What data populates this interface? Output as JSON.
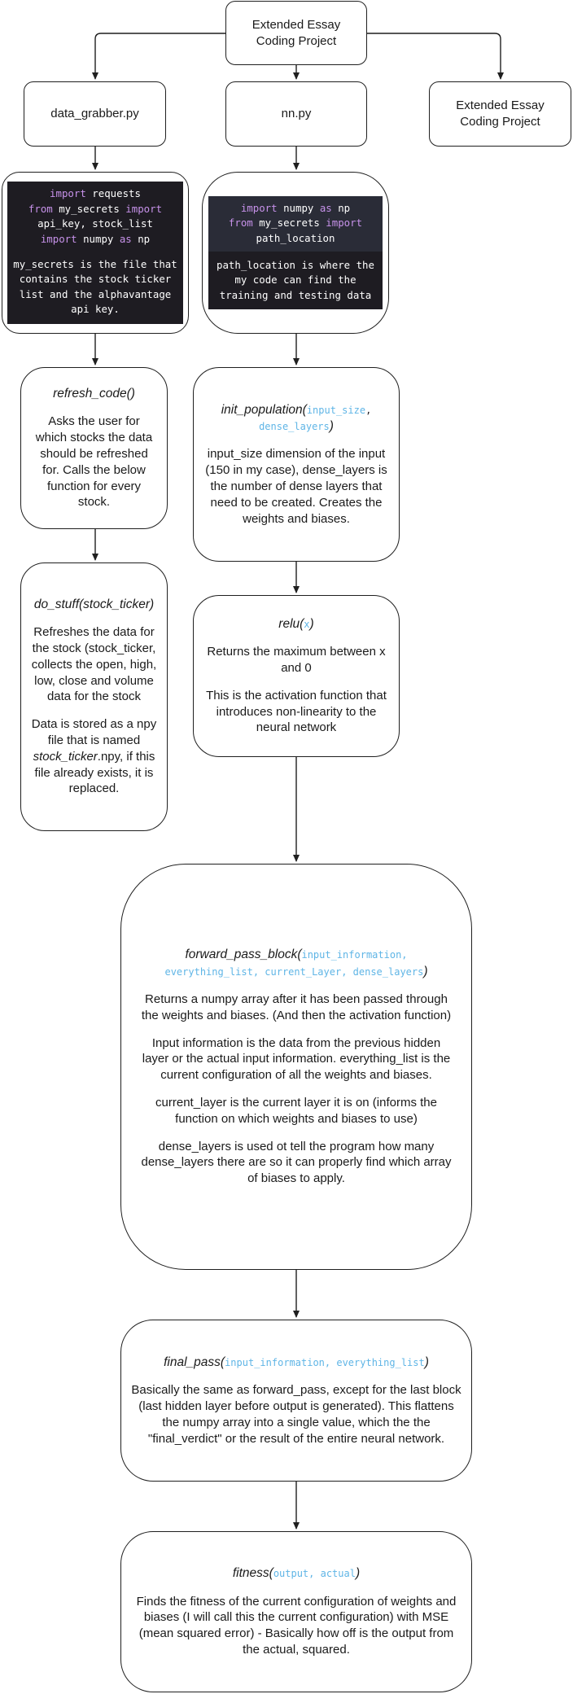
{
  "nodes": {
    "root": {
      "label_line1": "Extended Essay",
      "label_line2": "Coding Project"
    },
    "data_grabber": {
      "label": "data_grabber.py"
    },
    "nn": {
      "label": "nn.py"
    },
    "side": {
      "label_line1": "Extended Essay",
      "label_line2": "Coding Project"
    },
    "data_imports": {
      "line1_kw": "import",
      "line1_rest": " requests",
      "line2_kw1": "from",
      "line2_mid": " my_secrets ",
      "line2_kw2": "import",
      "line3": "api_key, stock_list",
      "line4_kw1": "import",
      "line4_mid": " numpy ",
      "line4_kw2": "as",
      "line4_end": " np",
      "comment1": "my_secrets is the file that",
      "comment2": "contains the stock ticker",
      "comment3": "list and the alphavantage",
      "comment4": "api key."
    },
    "nn_imports": {
      "line1_kw": "import",
      "line1_mid": " numpy ",
      "line1_kw2": "as",
      "line1_end": " np",
      "line2_kw1": "from",
      "line2_mid": " my_secrets ",
      "line2_kw2": "import",
      "line3": "path_location",
      "comment1": "path_location is where the",
      "comment2": "my code can find the",
      "comment3": "training and testing data"
    },
    "refresh": {
      "title": "refresh_code()",
      "desc": "Asks the user for which stocks the data should be refreshed for. Calls the below function for every stock."
    },
    "init_pop": {
      "title": "init_population(",
      "param1": "input_size",
      "param_sep": ",",
      "param2": "dense_layers",
      "close": ")",
      "desc": "input_size dimension of the input (150 in my case), dense_layers is the number of dense layers that need to be created. Creates the weights and biases."
    },
    "do_stuff": {
      "title": "do_stuff(stock_ticker)",
      "desc1": "Refreshes the data for the stock (stock_ticker, collects the open, high, low, close and volume data for the stock",
      "desc2_a": "Data is stored as a npy file that is named ",
      "desc2_ital": "stock_ticker",
      "desc2_b": ".npy, if this file already exists, it is replaced."
    },
    "relu": {
      "title": "relu(",
      "param": "x",
      "close": ")",
      "desc1": "Returns the maximum between x and 0",
      "desc2": "This is the activation function that introduces non-linearity to the neural network"
    },
    "forward": {
      "title": "forward_pass_block(",
      "params": "input_information, everything_list, current_Layer, dense_layers",
      "close": ")",
      "desc1": "Returns a numpy array after it has been passed through the weights and biases. (And then the activation function)",
      "desc2": "Input information is the data from the previous hidden layer or the actual input information. everything_list is the current configuration of all the weights and biases.",
      "desc3": "current_layer is the current layer it is on (informs the function on which weights and biases to use)",
      "desc4": "dense_layers is used ot tell the program how many dense_layers there are so it can properly find which array of biases to apply."
    },
    "final": {
      "title": "final_pass(",
      "params": "input_information, everything_list",
      "close": ")",
      "desc": "Basically the same as forward_pass, except for the last block (last hidden layer before output is generated). This flattens the numpy array into a single value, which the the \"final_verdict\" or the result of the entire neural network."
    },
    "fitness": {
      "title": "fitness(",
      "params": "output, actual",
      "close": ")",
      "desc": "Finds the fitness of the current configuration of weights and biases (I will call this the current configuration) with MSE (mean squared error) - Basically how off is the output from the actual, squared."
    }
  },
  "colors": {
    "stroke": "#1f1f1f",
    "param": "#5fb5e6",
    "keyword": "#c792ea",
    "code_bg": "#1e1c22",
    "code_bg_alt": "#2a2c37"
  }
}
